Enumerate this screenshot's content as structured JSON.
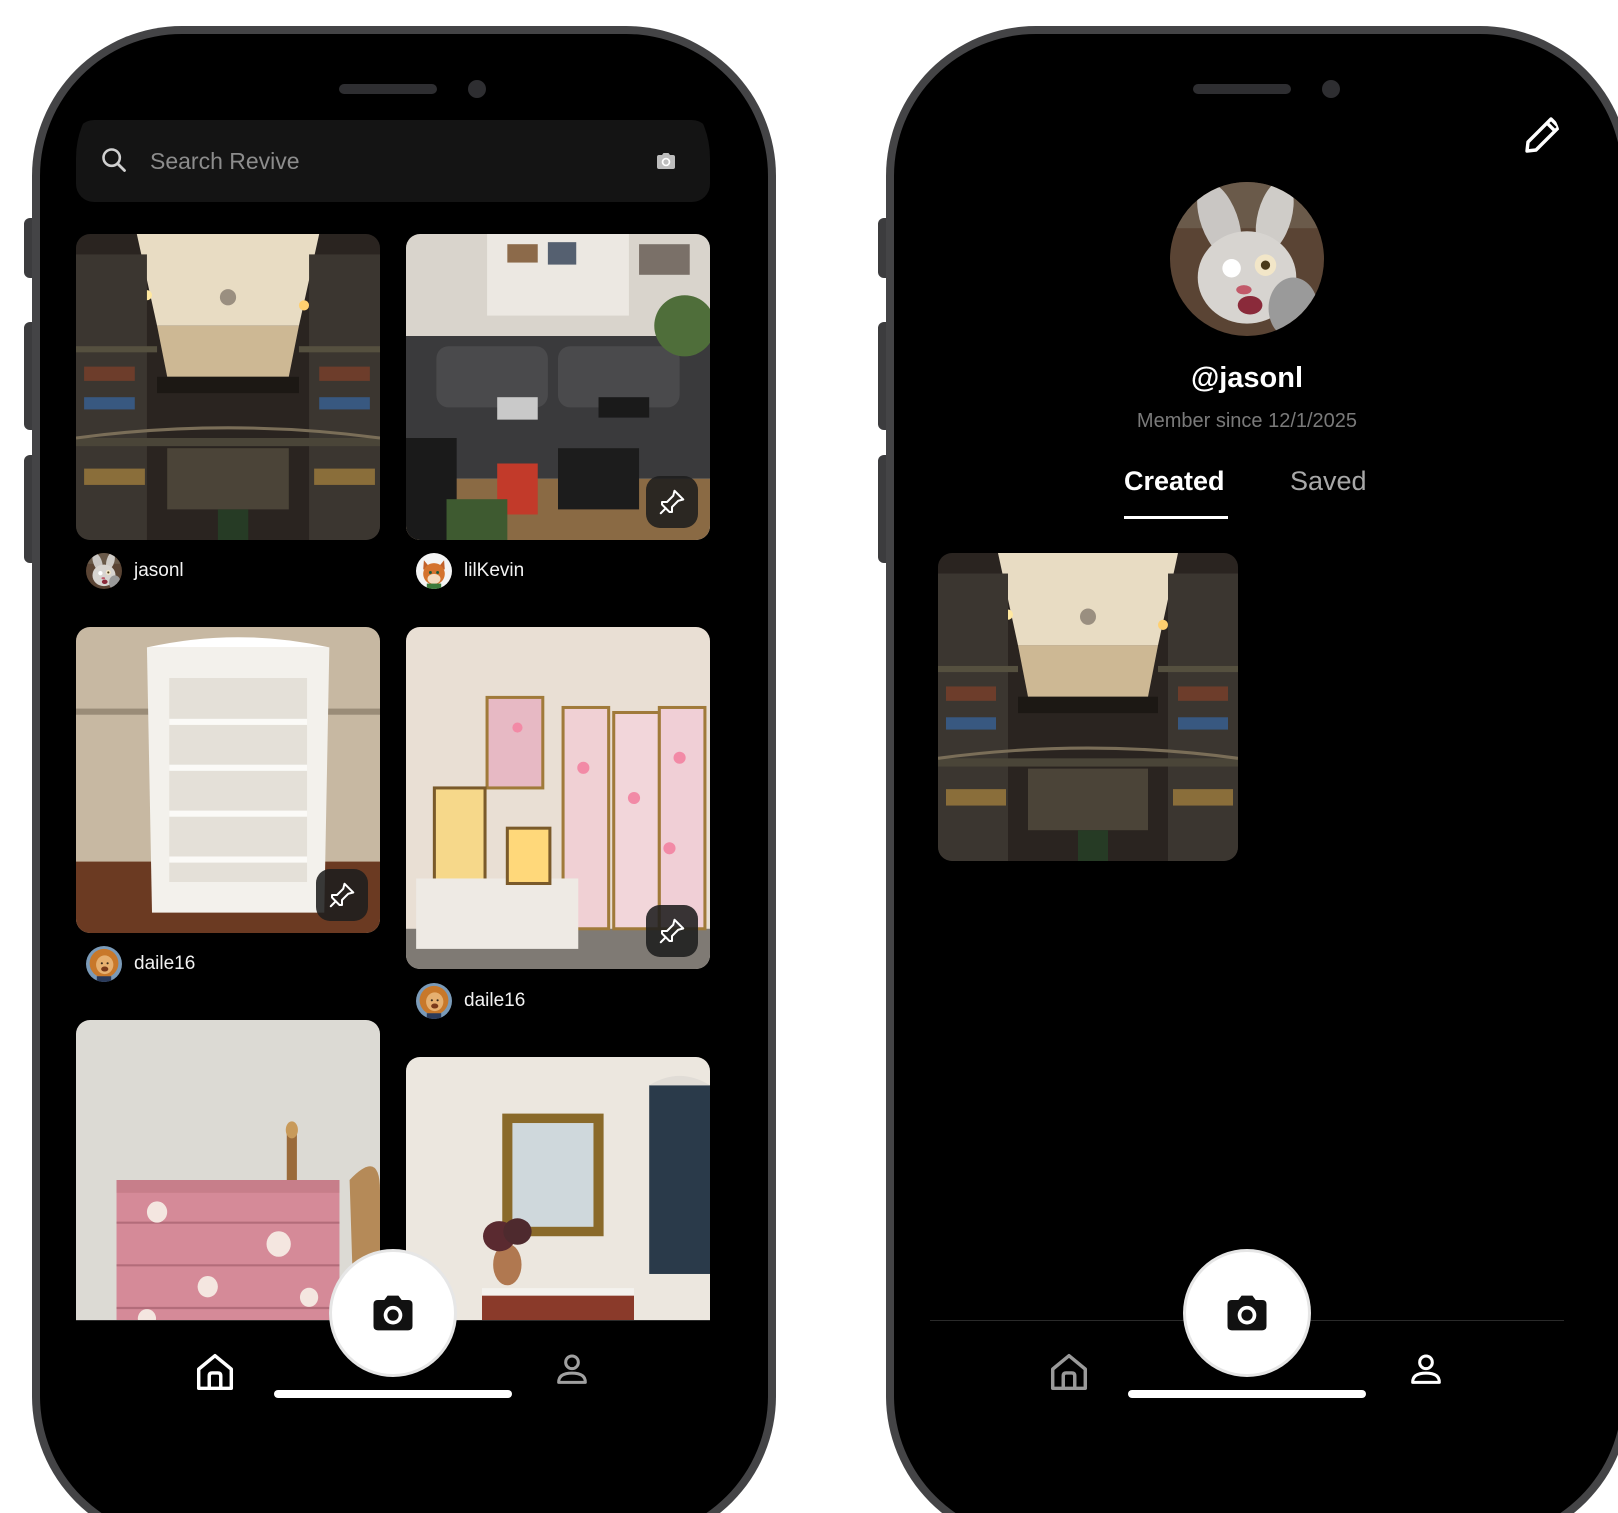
{
  "feed_screen": {
    "search": {
      "placeholder": "Search Revive",
      "icon": "search-icon",
      "camera_icon": "camera-icon"
    },
    "posts": [
      {
        "username": "jasonl",
        "image": "library interior photo",
        "repin": false
      },
      {
        "username": "lilKevin",
        "image": "living room couch photo",
        "repin": true
      },
      {
        "username": "daile16",
        "image": "white bookshelf photo",
        "repin": true
      },
      {
        "username": "daile16",
        "image": "lamps and folding screen photo",
        "repin": true
      },
      {
        "username": "",
        "image": "pink floral dresser photo",
        "repin": false
      },
      {
        "username": "",
        "image": "mirror and console table photo",
        "repin": false
      }
    ],
    "tabbar": {
      "home_icon": "home-icon",
      "camera_icon": "camera-icon",
      "profile_icon": "profile-icon",
      "active": "home"
    }
  },
  "profile_screen": {
    "handle": "@jasonl",
    "member_since": "Member since 12/1/2025",
    "tabs": [
      {
        "label": "Created",
        "active": true
      },
      {
        "label": "Saved",
        "active": false
      }
    ],
    "created_posts": [
      {
        "image": "library interior photo"
      }
    ],
    "edit_icon": "pencil-icon",
    "tabbar": {
      "home_icon": "home-icon",
      "camera_icon": "camera-icon",
      "profile_icon": "profile-icon",
      "active": "profile"
    }
  },
  "colors": {
    "background": "#000000",
    "frame": "#444446",
    "search_bg": "#141414",
    "muted_text": "#7a7a7a",
    "fab": "#ffffff"
  }
}
